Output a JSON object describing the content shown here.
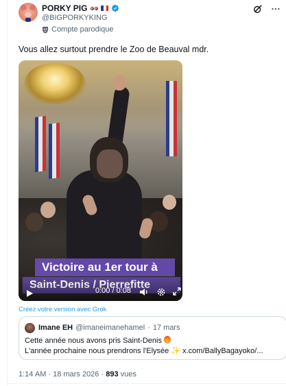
{
  "author": {
    "display_name": "PORKY PIG",
    "handle": "@BIGPORKYKING",
    "label": "Compte parodique"
  },
  "tweet": {
    "text": "Vous allez surtout prendre le Zoo de Beauval mdr."
  },
  "video": {
    "caption_line1": "Victoire au 1er tour à",
    "caption_line2": "Saint-Denis / Pierrefitte",
    "time": "0:00 / 0:08"
  },
  "grok_link": "Créez votre version avec Grok",
  "quote": {
    "name": "Imane EH",
    "handle": "@imaneimanehamel",
    "separator": "·",
    "date": "17 mars",
    "line1": "Cette année nous avons pris Saint-Denis",
    "line2": "L'année prochaine nous prendrons l'Elysée",
    "link": "x.com/BallyBagayoko/..."
  },
  "footer": {
    "time": "1:14 AM",
    "separator": "·",
    "date": "18 mars 2026",
    "views_count": "893",
    "views_label": "vues"
  },
  "colors": {
    "link_blue": "#1d9bf0",
    "secondary_text": "#536471",
    "caption_purple": "#6e50be"
  },
  "icons": [
    "verified-badge-icon",
    "parody-mask-icon",
    "grok-slash-icon",
    "more-icon",
    "play-icon",
    "volume-icon",
    "settings-icon",
    "fullscreen-icon",
    "fire-emoji-icon",
    "sparkles-emoji-icon"
  ]
}
